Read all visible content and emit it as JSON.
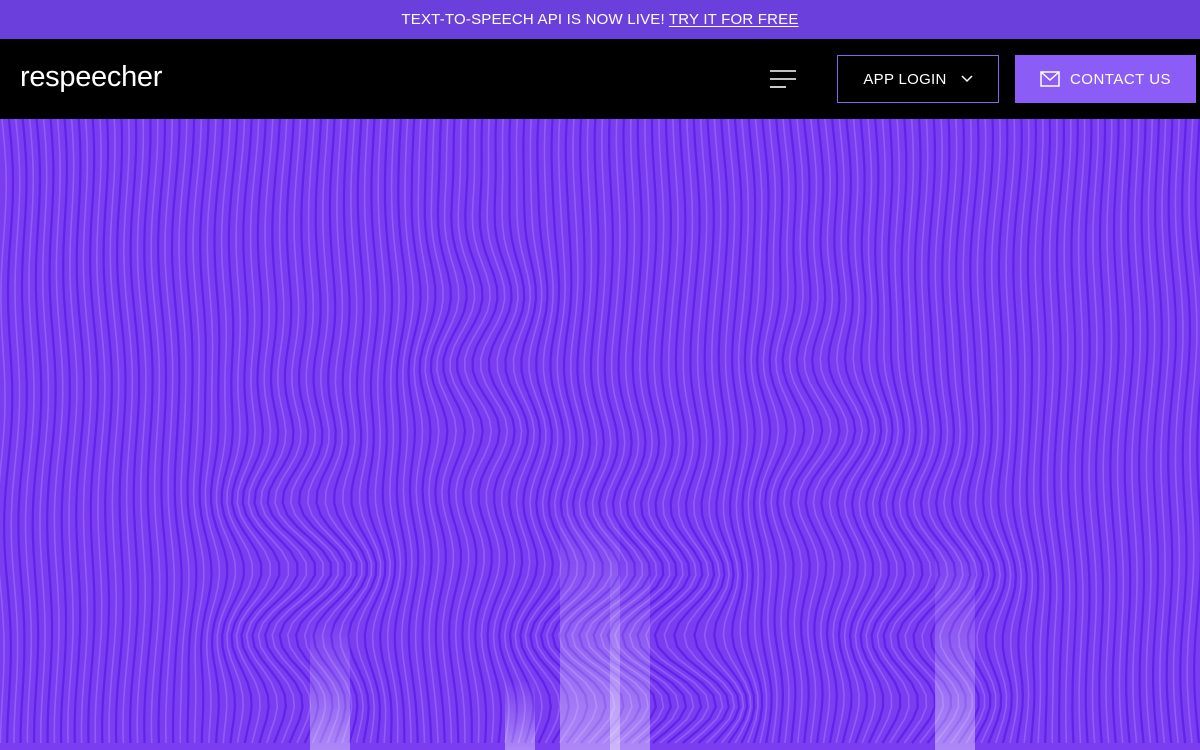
{
  "announcement": {
    "message": "TEXT-TO-SPEECH API IS NOW LIVE!",
    "link_label": "TRY IT FOR FREE"
  },
  "header": {
    "logo": "respeecher",
    "menu_icon": "hamburger-icon",
    "app_login_label": "APP LOGIN",
    "app_login_icon": "chevron-down-icon",
    "contact_label": "CONTACT US",
    "contact_icon": "mail-icon"
  },
  "colors": {
    "announcement_bg": "#6b3fdb",
    "nav_bg": "#000000",
    "accent": "#8b5cf6",
    "hero_base": "#7a3df0",
    "hero_deep": "#5a1ee8",
    "hero_highlight": "#ffffff"
  }
}
